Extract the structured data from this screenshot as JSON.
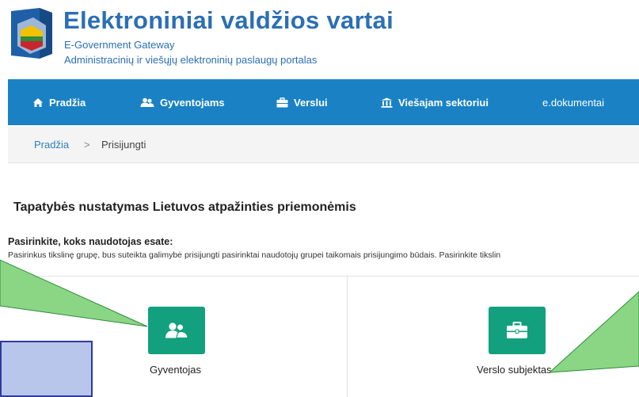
{
  "header": {
    "title": "Elektroniniai valdžios vartai",
    "subtitle_en": "E-Government Gateway",
    "subtitle_lt": "Administracinių ir viešųjų elektroninių paslaugų portalas",
    "logo_icon": "gateway-coat-of-arms-icon"
  },
  "nav": {
    "items": [
      {
        "label": "Pradžia",
        "icon": "home-icon"
      },
      {
        "label": "Gyventojams",
        "icon": "users-icon"
      },
      {
        "label": "Verslui",
        "icon": "briefcase-icon"
      },
      {
        "label": "Viešajam sektoriui",
        "icon": "institution-icon"
      },
      {
        "label": "e.dokumentai",
        "icon": ""
      }
    ]
  },
  "breadcrumb": {
    "home": "Pradžia",
    "separator": ">",
    "current": "Prisijungti"
  },
  "content": {
    "title": "Tapatybės nustatymas Lietuvos atpažinties priemonėmis",
    "choose_label": "Pasirinkite, koks naudotojas esate:",
    "choose_desc": "Pasirinkus tikslinę grupę, bus suteikta galimybė prisijungti pasirinktai naudotojų grupei taikomais prisijungimo būdais. Pasirinkite tikslin"
  },
  "cards": [
    {
      "label": "Gyventojas",
      "icon": "users-icon"
    },
    {
      "label": "Verslo subjektas",
      "icon": "briefcase-icon"
    }
  ],
  "colors": {
    "brand_blue": "#2b6fb5",
    "nav_blue": "#1a82c4",
    "card_green": "#13a07f",
    "annotation_green": "#8bd685",
    "annotation_box": "#b9c6ec"
  }
}
